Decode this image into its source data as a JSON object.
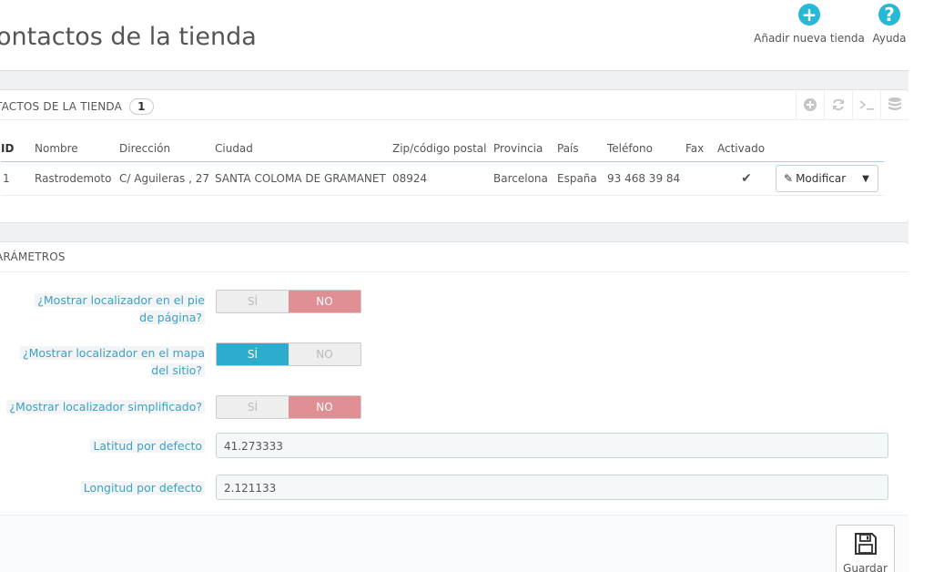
{
  "page": {
    "title": "ontactos de la tienda",
    "toolbar": {
      "add_label": "Añadir nueva tienda",
      "help_label": "Ayuda"
    }
  },
  "contacts_panel": {
    "title": "TACTOS DE LA TIENDA",
    "count": "1",
    "actions": [
      "add-icon",
      "refresh-icon",
      "sql-icon",
      "database-icon"
    ],
    "columns": [
      "ID",
      "Nombre",
      "Dirección",
      "Ciudad",
      "Zip/código postal",
      "Provincia",
      "País",
      "Teléfono",
      "Fax",
      "Activado"
    ],
    "rows": [
      {
        "id": "1",
        "name": "Rastrodemoto",
        "address": "C/ Aguileras , 27",
        "city": "SANTA COLOMA DE GRAMANET",
        "zip": "08924",
        "province": "Barcelona",
        "country": "España",
        "phone": "93 468 39 84",
        "fax": "",
        "active": true,
        "action_label": "Modificar"
      }
    ]
  },
  "params_panel": {
    "title": "ARÁMETROS",
    "switch_yes": "SÍ",
    "switch_no": "NO",
    "fields": {
      "footer_locator": {
        "label": "¿Mostrar localizador en el pie de página?",
        "value": "NO"
      },
      "sitemap_locator": {
        "label": "¿Mostrar localizador en el mapa del sitio?",
        "value": "SÍ"
      },
      "simplified_locator": {
        "label": "¿Mostrar localizador simplificado?",
        "value": "NO"
      },
      "default_latitude": {
        "label": "Latitud por defecto",
        "value": "41.273333"
      },
      "default_longitude": {
        "label": "Longitud por defecto",
        "value": "2.121133"
      }
    },
    "save_label": "Guardar"
  },
  "colors": {
    "accent": "#25b9d7",
    "switch_yes": "#2eacce",
    "switch_no": "#e08f95",
    "active_check": "#72c279",
    "label_text": "#3ca2c5"
  }
}
